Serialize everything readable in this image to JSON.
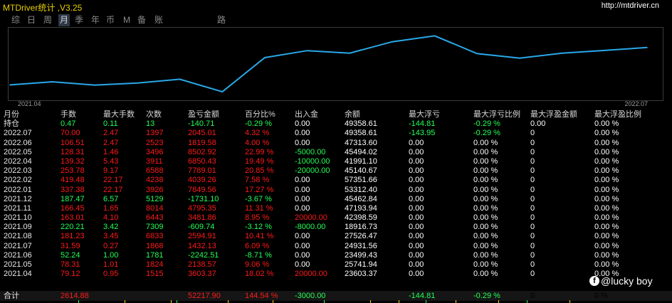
{
  "app": {
    "title": "MTDriver统计 ,V3.25",
    "url": "http://mtdriver.cn"
  },
  "tabs": [
    {
      "label": "综",
      "active": false
    },
    {
      "label": "日",
      "active": false
    },
    {
      "label": "周",
      "active": false
    },
    {
      "label": "月",
      "active": true
    },
    {
      "label": "季",
      "active": false
    },
    {
      "label": "年",
      "active": false
    },
    {
      "label": "币",
      "active": false
    },
    {
      "label": "M",
      "active": false
    },
    {
      "label": "备",
      "active": false
    },
    {
      "label": "账户",
      "active": false
    },
    {
      "label": "路径",
      "active": false
    }
  ],
  "chart_data": {
    "type": "line",
    "x_start_label": "2021.04",
    "x_end_label": "2022.07",
    "line_color": "#2aa8e8",
    "x": [
      "2021.04",
      "2021.05",
      "2021.06",
      "2021.07",
      "2021.08",
      "2021.09",
      "2021.10",
      "2021.11",
      "2021.12",
      "2022.01",
      "2022.02",
      "2022.03",
      "2022.04",
      "2022.05",
      "2022.06",
      "2022.07"
    ],
    "values": [
      23603.37,
      25741.94,
      23499.43,
      24931.56,
      27526.47,
      18916.73,
      42398.59,
      47193.94,
      45462.84,
      53312.4,
      57351.66,
      45140.67,
      41991.1,
      45494.02,
      47313.6,
      49358.61
    ]
  },
  "table": {
    "headers": [
      "月份",
      "手数",
      "最大手数",
      "次数",
      "盈亏金额",
      "百分比%",
      "出入金",
      "余额",
      "最大浮亏",
      "最大浮亏比例",
      "最大浮盈金额",
      "最大浮盈比例"
    ],
    "rows": [
      {
        "cells": [
          "持仓",
          "0.47",
          "0.11",
          "13",
          "-140.71",
          "-0.29 %",
          "0.00",
          "49358.61",
          "-144.81",
          "-0.29 %",
          "0.00",
          "0.00 %"
        ],
        "colors": [
          "w",
          "g",
          "g",
          "g",
          "g",
          "g",
          "w",
          "w",
          "g",
          "g",
          "w",
          "w"
        ]
      },
      {
        "cells": [
          "2022.07",
          "70.00",
          "2.47",
          "1397",
          "2045.01",
          "4.32 %",
          "0.00",
          "49358.61",
          "-143.95",
          "-0.29 %",
          "0",
          "0.00 %"
        ],
        "colors": [
          "w",
          "r",
          "r",
          "r",
          "r",
          "r",
          "w",
          "w",
          "g",
          "g",
          "w",
          "w"
        ]
      },
      {
        "cells": [
          "2022.06",
          "106.51",
          "2.47",
          "2523",
          "1819.58",
          "4.00 %",
          "0.00",
          "47313.60",
          "0.00",
          "0.00 %",
          "0",
          "0.00 %"
        ],
        "colors": [
          "w",
          "r",
          "r",
          "r",
          "r",
          "r",
          "w",
          "w",
          "w",
          "w",
          "w",
          "w"
        ]
      },
      {
        "cells": [
          "2022.05",
          "128.31",
          "1.46",
          "3496",
          "8502.92",
          "22.99 %",
          "-5000.00",
          "45494.02",
          "0.00",
          "0.00 %",
          "0",
          "0.00 %"
        ],
        "colors": [
          "w",
          "r",
          "r",
          "r",
          "r",
          "r",
          "g",
          "w",
          "w",
          "w",
          "w",
          "w"
        ]
      },
      {
        "cells": [
          "2022.04",
          "139.32",
          "5.43",
          "3911",
          "6850.43",
          "19.49 %",
          "-10000.00",
          "41991.10",
          "0.00",
          "0.00 %",
          "0",
          "0.00 %"
        ],
        "colors": [
          "w",
          "r",
          "r",
          "r",
          "r",
          "r",
          "g",
          "w",
          "w",
          "w",
          "w",
          "w"
        ]
      },
      {
        "cells": [
          "2022.03",
          "253.78",
          "9.17",
          "6588",
          "7789.01",
          "20.85 %",
          "-20000.00",
          "45140.67",
          "0.00",
          "0.00 %",
          "0",
          "0.00 %"
        ],
        "colors": [
          "w",
          "r",
          "r",
          "r",
          "r",
          "r",
          "g",
          "w",
          "w",
          "w",
          "w",
          "w"
        ]
      },
      {
        "cells": [
          "2022.02",
          "419.48",
          "22.17",
          "4238",
          "4039.26",
          "7.58 %",
          "0.00",
          "57351.66",
          "0.00",
          "0.00 %",
          "0",
          "0.00 %"
        ],
        "colors": [
          "w",
          "r",
          "r",
          "r",
          "r",
          "r",
          "w",
          "w",
          "w",
          "w",
          "w",
          "w"
        ]
      },
      {
        "cells": [
          "2022.01",
          "337.38",
          "22.17",
          "3926",
          "7849.56",
          "17.27 %",
          "0.00",
          "53312.40",
          "0.00",
          "0.00 %",
          "0",
          "0.00 %"
        ],
        "colors": [
          "w",
          "r",
          "r",
          "r",
          "r",
          "r",
          "w",
          "w",
          "w",
          "w",
          "w",
          "w"
        ]
      },
      {
        "cells": [
          "2021.12",
          "187.47",
          "6.57",
          "5129",
          "-1731.10",
          "-3.67 %",
          "0.00",
          "45462.84",
          "0.00",
          "0.00 %",
          "0",
          "0.00 %"
        ],
        "colors": [
          "w",
          "g",
          "g",
          "g",
          "g",
          "g",
          "w",
          "w",
          "w",
          "w",
          "w",
          "w"
        ]
      },
      {
        "cells": [
          "2021.11",
          "166.45",
          "1.65",
          "8014",
          "4795.35",
          "11.31 %",
          "0.00",
          "47193.94",
          "0.00",
          "0.00 %",
          "0",
          "0.00 %"
        ],
        "colors": [
          "w",
          "r",
          "r",
          "r",
          "r",
          "r",
          "w",
          "w",
          "w",
          "w",
          "w",
          "w"
        ]
      },
      {
        "cells": [
          "2021.10",
          "163.01",
          "4.10",
          "6443",
          "3481.86",
          "8.95 %",
          "20000.00",
          "42398.59",
          "0.00",
          "0.00 %",
          "0",
          "0.00 %"
        ],
        "colors": [
          "w",
          "r",
          "r",
          "r",
          "r",
          "r",
          "r",
          "w",
          "w",
          "w",
          "w",
          "w"
        ]
      },
      {
        "cells": [
          "2021.09",
          "220.21",
          "3.42",
          "7309",
          "-609.74",
          "-3.12 %",
          "-8000.00",
          "18916.73",
          "0.00",
          "0.00 %",
          "0",
          "0.00 %"
        ],
        "colors": [
          "w",
          "g",
          "g",
          "g",
          "g",
          "g",
          "g",
          "w",
          "w",
          "w",
          "w",
          "w"
        ]
      },
      {
        "cells": [
          "2021.08",
          "181.23",
          "3.45",
          "6833",
          "2594.91",
          "10.41 %",
          "0.00",
          "27526.47",
          "0.00",
          "0.00 %",
          "0",
          "0.00 %"
        ],
        "colors": [
          "w",
          "r",
          "r",
          "r",
          "r",
          "r",
          "w",
          "w",
          "w",
          "w",
          "w",
          "w"
        ]
      },
      {
        "cells": [
          "2021.07",
          "31.59",
          "0.27",
          "1868",
          "1432.13",
          "6.09 %",
          "0.00",
          "24931.56",
          "0.00",
          "0.00 %",
          "0",
          "0.00 %"
        ],
        "colors": [
          "w",
          "r",
          "r",
          "r",
          "r",
          "r",
          "w",
          "w",
          "w",
          "w",
          "w",
          "w"
        ]
      },
      {
        "cells": [
          "2021.06",
          "52.24",
          "1.00",
          "1781",
          "-2242.51",
          "-8.71 %",
          "0.00",
          "23499.43",
          "0.00",
          "0.00 %",
          "0",
          "0.00 %"
        ],
        "colors": [
          "w",
          "g",
          "g",
          "g",
          "g",
          "g",
          "w",
          "w",
          "w",
          "w",
          "w",
          "w"
        ]
      },
      {
        "cells": [
          "2021.05",
          "78.31",
          "1.01",
          "1824",
          "2138.57",
          "9.06 %",
          "0.00",
          "25741.94",
          "0.00",
          "0.00 %",
          "0",
          "0.00 %"
        ],
        "colors": [
          "w",
          "r",
          "r",
          "r",
          "r",
          "r",
          "w",
          "w",
          "w",
          "w",
          "w",
          "w"
        ]
      },
      {
        "cells": [
          "2021.04",
          "79.12",
          "0.95",
          "1515",
          "3603.37",
          "18.02 %",
          "20000.00",
          "23603.37",
          "0.00",
          "0.00 %",
          "0",
          "0.00 %"
        ],
        "colors": [
          "w",
          "r",
          "r",
          "r",
          "r",
          "r",
          "r",
          "w",
          "w",
          "w",
          "w",
          "w"
        ]
      }
    ],
    "total": {
      "cells": [
        "合计",
        "2614.88",
        "",
        "",
        "52217.90",
        "144.54 %",
        "-3000.00",
        "",
        "-144.81",
        "-0.29 %",
        "0",
        "0 %"
      ],
      "colors": [
        "w",
        "r",
        "w",
        "w",
        "r",
        "r",
        "g",
        "w",
        "g",
        "g",
        "w",
        "w"
      ]
    }
  },
  "watermark": {
    "text": "@lucky boy"
  }
}
